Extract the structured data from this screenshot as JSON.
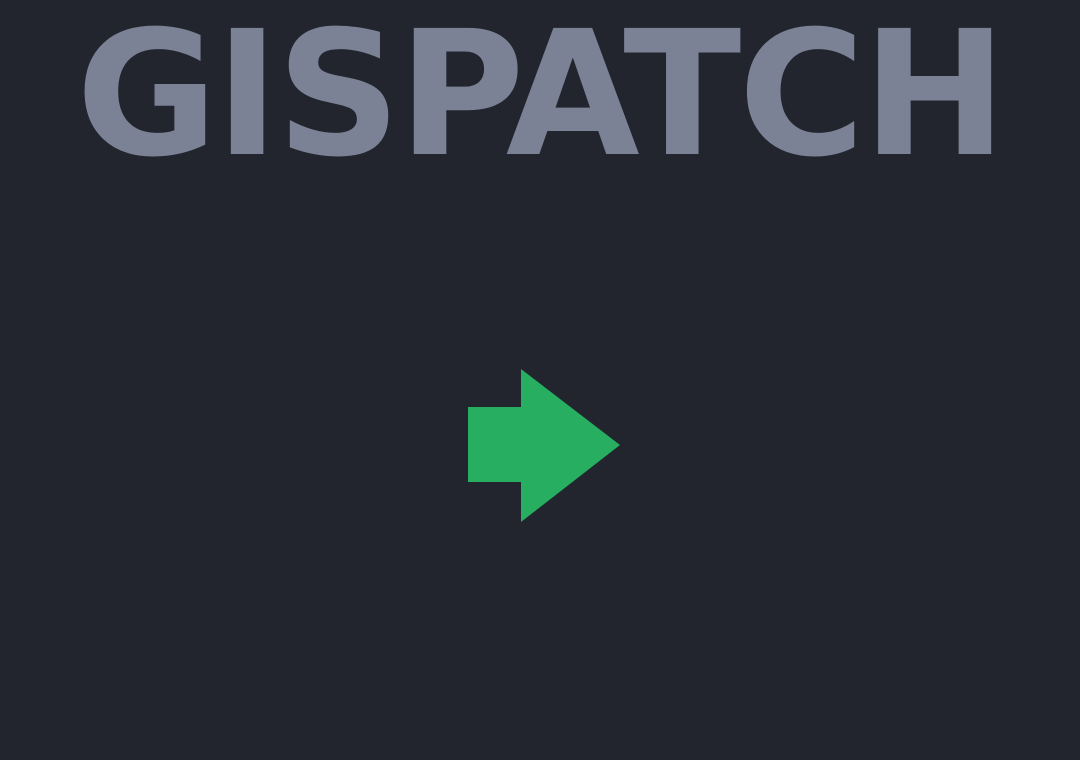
{
  "app": {
    "logo_text": "GISPATCH"
  },
  "arrow": {
    "icon": "arrow-right-icon",
    "color": "#27ae60"
  },
  "colors": {
    "background": "#22252d",
    "logo": "#7b8295"
  }
}
